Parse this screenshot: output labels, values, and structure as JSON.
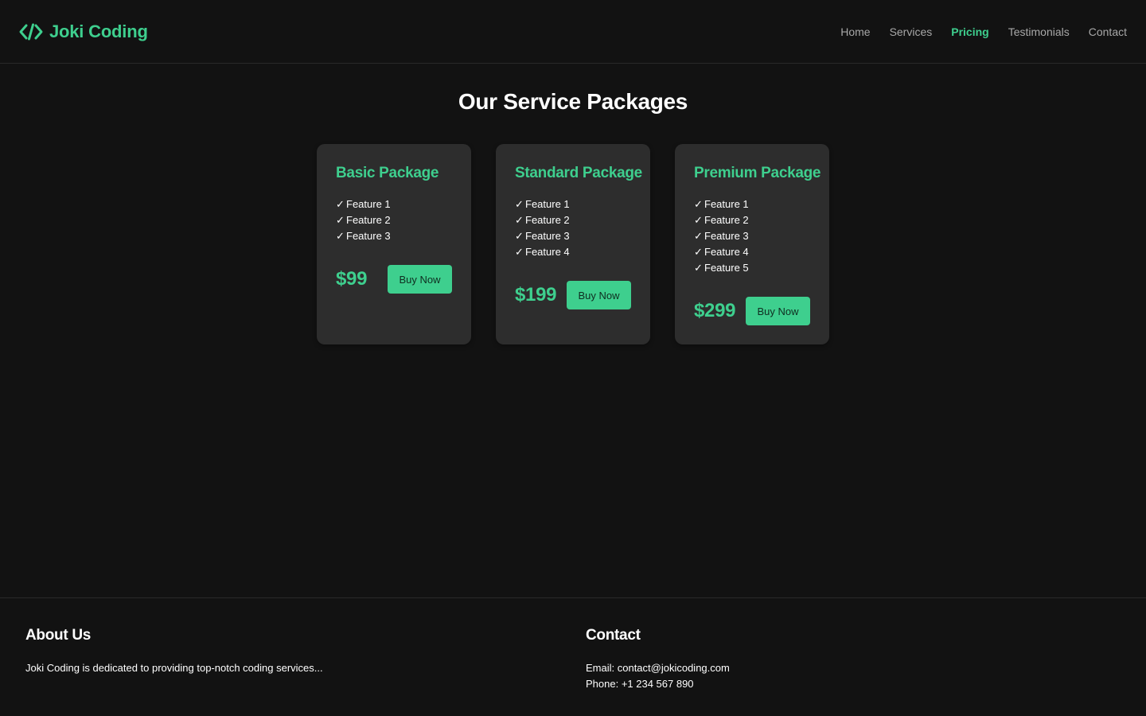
{
  "header": {
    "brand_name": "Joki Coding",
    "brand_icon": "code-brackets-icon",
    "nav": [
      {
        "label": "Home",
        "active": false
      },
      {
        "label": "Services",
        "active": false
      },
      {
        "label": "Pricing",
        "active": true
      },
      {
        "label": "Testimonials",
        "active": false
      },
      {
        "label": "Contact",
        "active": false
      }
    ]
  },
  "main": {
    "title": "Our Service Packages",
    "packages": [
      {
        "name": "Basic Package",
        "features": [
          "Feature 1",
          "Feature 2",
          "Feature 3"
        ],
        "price": "$99",
        "button": "Buy Now"
      },
      {
        "name": "Standard Package",
        "features": [
          "Feature 1",
          "Feature 2",
          "Feature 3",
          "Feature 4"
        ],
        "price": "$199",
        "button": "Buy Now"
      },
      {
        "name": "Premium Package",
        "features": [
          "Feature 1",
          "Feature 2",
          "Feature 3",
          "Feature 4",
          "Feature 5"
        ],
        "price": "$299",
        "button": "Buy Now"
      }
    ],
    "check_glyph": "✓"
  },
  "footer": {
    "about": {
      "heading": "About Us",
      "text": "Joki Coding is dedicated to providing top-notch coding services..."
    },
    "contact": {
      "heading": "Contact",
      "email": "Email: contact@jokicoding.com",
      "phone": "Phone: +1 234 567 890"
    }
  },
  "colors": {
    "background": "#121212",
    "card": "#2d2d2d",
    "accent": "#3ecf8e",
    "nav_text": "#a8a8a8"
  }
}
